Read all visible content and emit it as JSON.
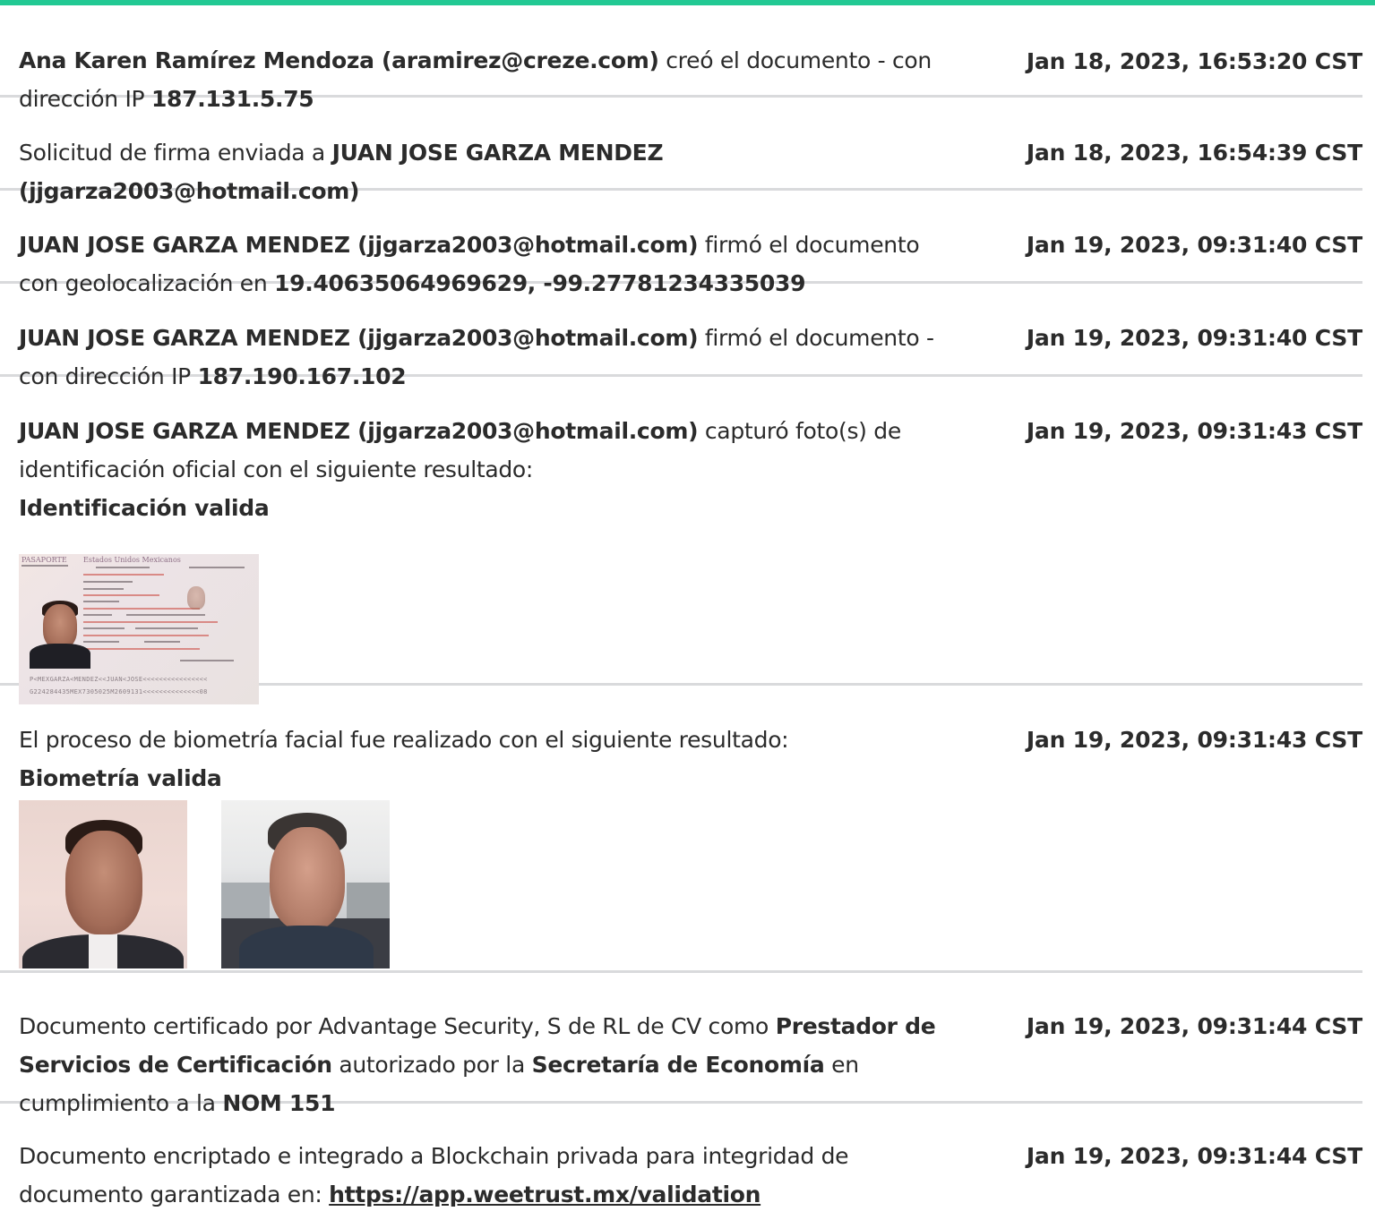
{
  "brand": {
    "accent": "#22c993"
  },
  "entries": [
    {
      "parts": [
        {
          "t": "Ana Karen Ramírez Mendoza (aramirez@creze.com)",
          "b": true
        },
        {
          "t": " creó el documento - con dirección IP "
        },
        {
          "t": "187.131.5.75",
          "b": true
        }
      ],
      "time": "Jan 18, 2023, 16:53:20 CST"
    },
    {
      "parts": [
        {
          "t": "Solicitud de firma enviada a "
        },
        {
          "t": "JUAN JOSE GARZA MENDEZ (jjgarza2003@hotmail.com)",
          "b": true
        }
      ],
      "time": "Jan 18, 2023, 16:54:39 CST"
    },
    {
      "parts": [
        {
          "t": "JUAN JOSE GARZA MENDEZ (jjgarza2003@hotmail.com)",
          "b": true
        },
        {
          "t": " firmó el documento con geolocalización en "
        },
        {
          "t": "19.40635064969629, -99.27781234335039",
          "b": true
        }
      ],
      "time": "Jan 19, 2023, 09:31:40 CST"
    },
    {
      "parts": [
        {
          "t": "JUAN JOSE GARZA MENDEZ (jjgarza2003@hotmail.com)",
          "b": true
        },
        {
          "t": " firmó el documento - con dirección IP "
        },
        {
          "t": "187.190.167.102",
          "b": true
        }
      ],
      "time": "Jan 19, 2023, 09:31:40 CST"
    },
    {
      "parts": [
        {
          "t": "JUAN JOSE GARZA MENDEZ (jjgarza2003@hotmail.com)",
          "b": true
        },
        {
          "t": " capturó foto(s) de identificación oficial con el siguiente resultado:"
        },
        {
          "br": true
        },
        {
          "t": "Identificación valida",
          "b": true
        }
      ],
      "time": "Jan 19, 2023, 09:31:43 CST",
      "passport": {
        "title": "PASAPORTE",
        "country": "Estados Unidos Mexicanos",
        "mrz1": "P<MEXGARZA<MENDEZ<<JUAN<JOSE<<<<<<<<<<<<<<<<",
        "mrz2": "G224284435MEX7305025M2609131<<<<<<<<<<<<<<08"
      }
    },
    {
      "parts": [
        {
          "t": "El proceso de biometría facial fue realizado con el siguiente resultado:"
        },
        {
          "br": true
        },
        {
          "t": "Biometría valida",
          "b": true
        }
      ],
      "time": "Jan 19, 2023, 09:31:43 CST",
      "faces": true
    },
    {
      "parts": [
        {
          "t": "Documento certificado por Advantage Security, S de RL de CV como "
        },
        {
          "t": "Prestador de Servicios de Certificación",
          "b": true
        },
        {
          "t": " autorizado por la "
        },
        {
          "t": "Secretaría de Economía",
          "b": true
        },
        {
          "t": " en cumplimiento a la "
        },
        {
          "t": "NOM 151",
          "b": true
        }
      ],
      "time": "Jan 19, 2023, 09:31:44 CST"
    },
    {
      "parts": [
        {
          "t": "Documento encriptado e integrado a Blockchain privada para integridad de documento garantizada en: "
        },
        {
          "t": "https://app.weetrust.mx/validation",
          "link": true
        }
      ],
      "time": "Jan 19, 2023, 09:31:44 CST"
    }
  ]
}
